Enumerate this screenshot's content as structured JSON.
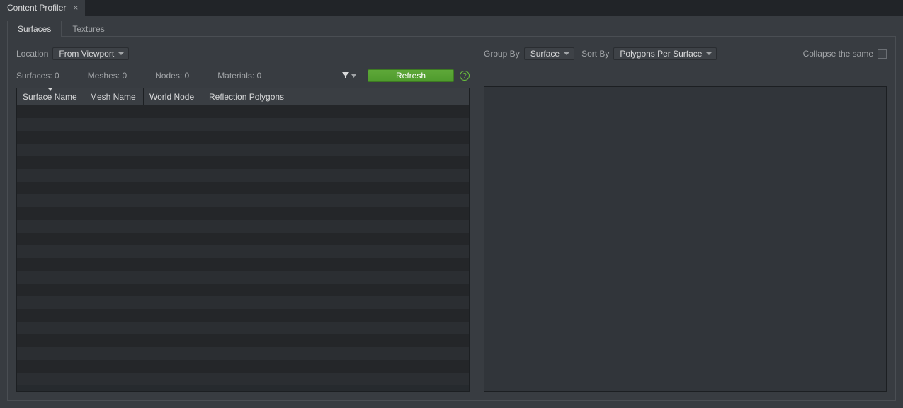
{
  "window_tabs": [
    {
      "label": "Content Profiler",
      "closable": true
    }
  ],
  "tabs": [
    {
      "id": "surfaces",
      "label": "Surfaces",
      "active": true
    },
    {
      "id": "textures",
      "label": "Textures",
      "active": false
    }
  ],
  "left": {
    "location_label": "Location",
    "location_value": "From Viewport",
    "stats": {
      "surfaces_label": "Surfaces:",
      "surfaces_value": "0",
      "meshes_label": "Meshes:",
      "meshes_value": "0",
      "nodes_label": "Nodes:",
      "nodes_value": "0",
      "materials_label": "Materials:",
      "materials_value": "0"
    },
    "refresh_label": "Refresh",
    "columns": [
      {
        "id": "surface_name",
        "label": "Surface Name",
        "width": 95,
        "sorted": true
      },
      {
        "id": "mesh_name",
        "label": "Mesh Name",
        "width": 84
      },
      {
        "id": "world_node",
        "label": "World Node",
        "width": 84
      },
      {
        "id": "reflection",
        "label": "Reflection Polygons"
      }
    ],
    "rows": []
  },
  "right": {
    "group_by_label": "Group By",
    "group_by_value": "Surface",
    "sort_by_label": "Sort By",
    "sort_by_value": "Polygons Per Surface",
    "collapse_label": "Collapse the same",
    "collapse_checked": false
  }
}
